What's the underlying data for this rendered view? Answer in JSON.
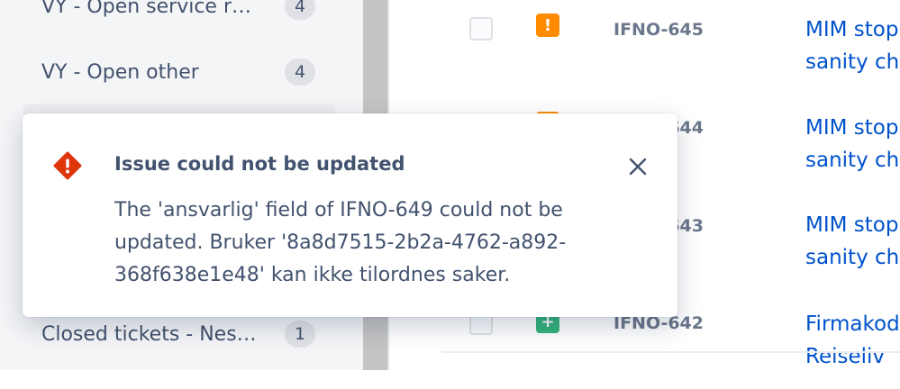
{
  "sidebar": {
    "items": [
      {
        "label": "VY - Open service r…",
        "count": "4"
      },
      {
        "label": "VY - Open other",
        "count": "4"
      },
      {
        "label": "",
        "count": ""
      },
      {
        "label": "Closed tickets - Nes…",
        "count": "1"
      }
    ]
  },
  "issues": [
    {
      "key": "IFNO-645",
      "priority": "!",
      "summary": [
        "MIM stop",
        "sanity che"
      ]
    },
    {
      "key": "IFNO-644",
      "priority": "",
      "summary": [
        "MIM stop",
        "sanity che"
      ]
    },
    {
      "key": "IFNO-643",
      "priority": "",
      "summary": [
        "MIM stop",
        "sanity che"
      ]
    },
    {
      "key": "IFNO-642",
      "priority": "+",
      "summary": [
        "Firmakod",
        "Reiseliv"
      ]
    }
  ],
  "flag": {
    "title": "Issue could not be updated",
    "body_lines": [
      "The 'ansvarlig' field of IFNO-649 could not be",
      "updated. Bruker '8a8d7515-2b2a-4762-a892-",
      "368f638e1e48' kan ikke tilordnes saker."
    ],
    "icon": "error-icon",
    "close_icon": "close-icon"
  },
  "colors": {
    "error": "#de350b",
    "priority_high": "#ff8b00",
    "priority_low": "#36b37e",
    "link": "#0052cc",
    "text": "#42526e"
  }
}
